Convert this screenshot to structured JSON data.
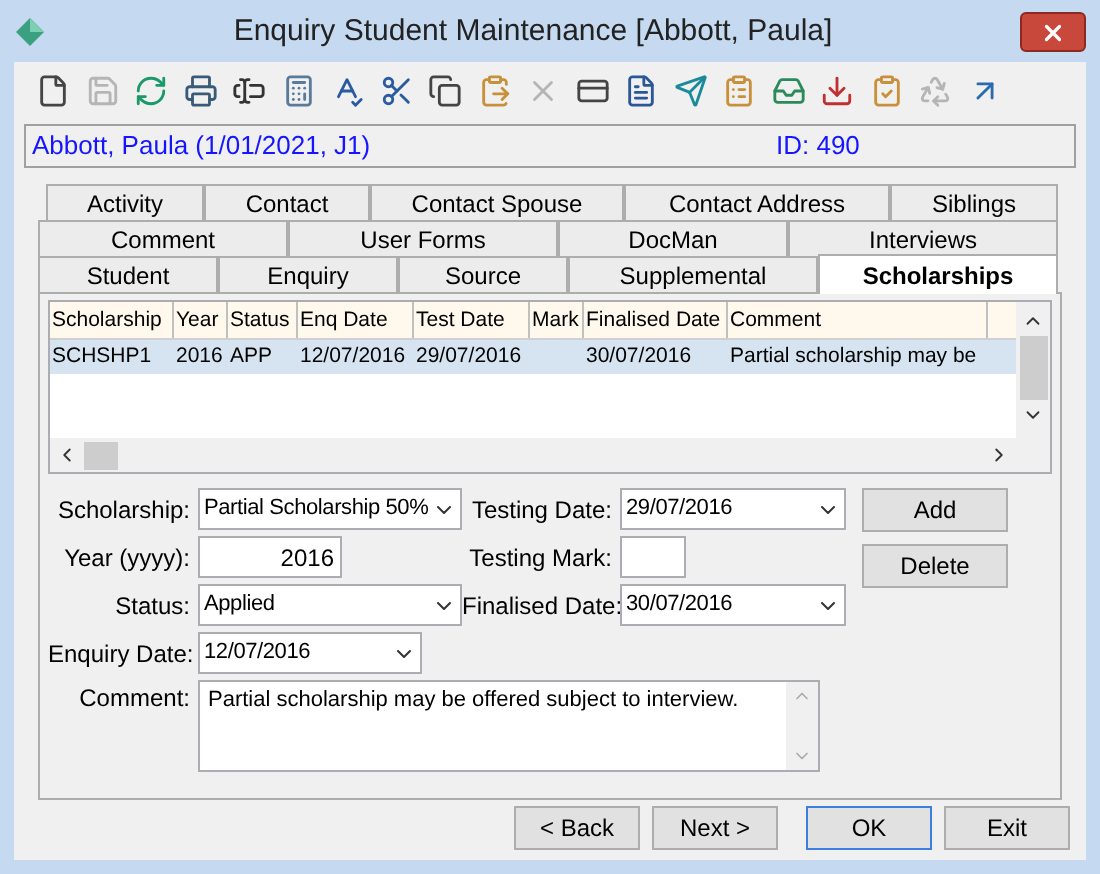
{
  "window": {
    "title": "Enquiry Student Maintenance  [Abbott, Paula]"
  },
  "toolbar": [
    {
      "disabled": false
    },
    {
      "disabled": true
    },
    {
      "disabled": false
    },
    {
      "disabled": false
    },
    {
      "disabled": false
    },
    {
      "disabled": false
    },
    {
      "disabled": false
    },
    {
      "disabled": false
    },
    {
      "disabled": false
    },
    {
      "disabled": false
    },
    {
      "disabled": true
    },
    {
      "disabled": false
    },
    {
      "disabled": false
    },
    {
      "disabled": false
    },
    {
      "disabled": false
    },
    {
      "disabled": false
    },
    {
      "disabled": false
    },
    {
      "disabled": false
    },
    {
      "disabled": true
    },
    {
      "disabled": false
    }
  ],
  "info_bar": {
    "student": "Abbott, Paula (1/01/2021, J1)",
    "id": "ID: 490"
  },
  "tab_rows": [
    {
      "tabs": [
        {
          "label": "Activity",
          "selected": false
        },
        {
          "label": "Contact",
          "selected": false
        },
        {
          "label": "Contact Spouse",
          "selected": false
        },
        {
          "label": "Contact Address",
          "selected": false
        },
        {
          "label": "Siblings",
          "selected": false
        }
      ]
    },
    {
      "tabs": [
        {
          "label": "Comment",
          "selected": false
        },
        {
          "label": "User Forms",
          "selected": false
        },
        {
          "label": "DocMan",
          "selected": false
        },
        {
          "label": "Interviews",
          "selected": false
        }
      ]
    },
    {
      "tabs": [
        {
          "label": "Student",
          "selected": false
        },
        {
          "label": "Enquiry",
          "selected": false
        },
        {
          "label": "Source",
          "selected": false
        },
        {
          "label": "Supplemental",
          "selected": false
        },
        {
          "label": "Scholarships",
          "selected": true
        }
      ]
    }
  ],
  "table": {
    "columns": [
      "Scholarship",
      "Year",
      "Status",
      "Enq Date",
      "Test Date",
      "Mark",
      "Finalised Date",
      "Comment"
    ],
    "rows": [
      {
        "selected": true,
        "cells": [
          "SCHSHP1",
          "2016",
          "APP",
          "12/07/2016",
          "29/07/2016",
          "",
          "30/07/2016",
          "Partial scholarship may be"
        ]
      }
    ]
  },
  "form": {
    "scholarship": {
      "label": "Scholarship:",
      "value": "Partial Scholarship 50%"
    },
    "year": {
      "label": "Year (yyyy):",
      "value": "2016"
    },
    "status": {
      "label": "Status:",
      "value": "Applied"
    },
    "enquiry_date": {
      "label": "Enquiry Date:",
      "value": "12/07/2016"
    },
    "comment": {
      "label": "Comment:",
      "value": "Partial scholarship may be offered subject to interview."
    },
    "testing_date": {
      "label": "Testing Date:",
      "value": "29/07/2016"
    },
    "testing_mark": {
      "label": "Testing Mark:"
    },
    "finalised_date": {
      "label": "Finalised Date:",
      "value": "30/07/2016"
    }
  },
  "side_buttons": [
    "Add",
    "Delete"
  ],
  "footer_buttons": [
    {
      "label": "< Back",
      "focused": false
    },
    {
      "label": "Next >",
      "focused": false
    },
    {
      "label": "OK",
      "focused": true
    },
    {
      "label": "Exit",
      "focused": false
    }
  ]
}
